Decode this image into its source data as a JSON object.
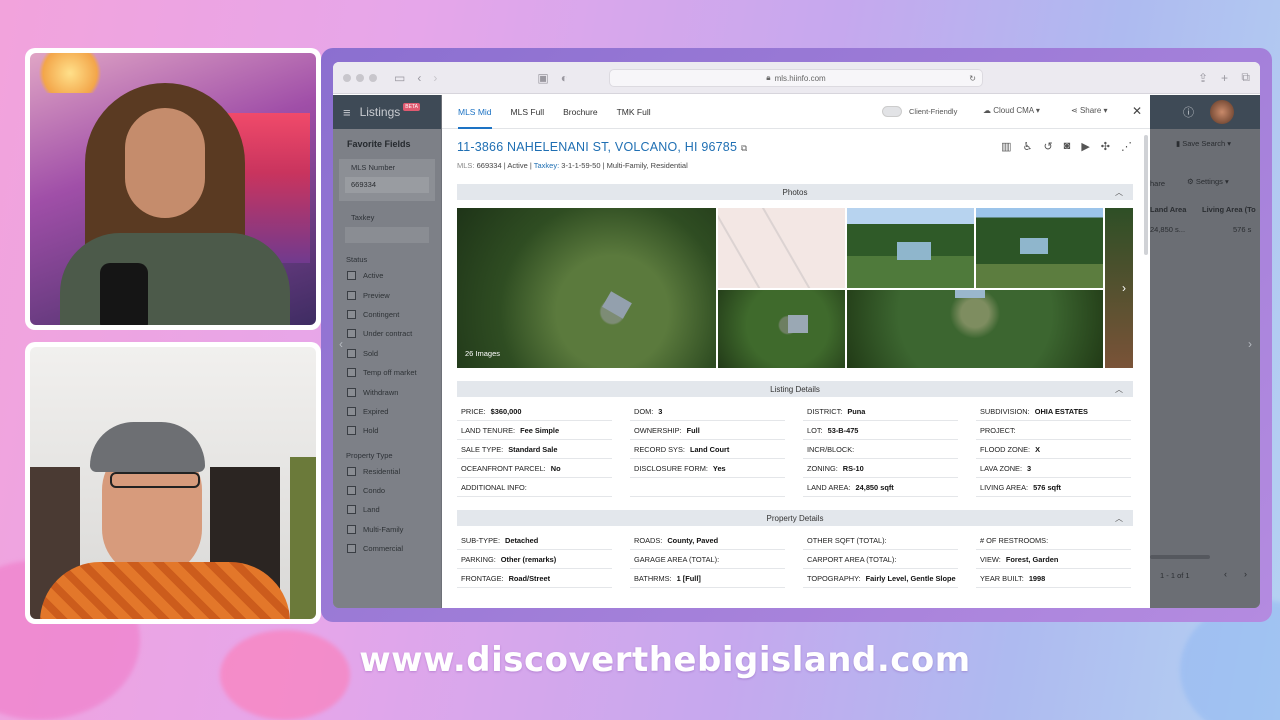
{
  "overlay": {
    "website": "www.discoverthebigisland.com"
  },
  "browser": {
    "url": "mls.hiinfo.com"
  },
  "app": {
    "brand": "Listings",
    "beta_badge": "BETA",
    "sidebar": {
      "section_title": "Favorite Fields",
      "mls_label": "MLS Number",
      "mls_value": "669334",
      "taxkey_label": "Taxkey",
      "status_label": "Status",
      "status_items": [
        "Active",
        "Preview",
        "Contingent",
        "Under contract",
        "Sold",
        "Temp off market",
        "Withdrawn",
        "Expired",
        "Hold"
      ],
      "ptype_label": "Property Type",
      "ptype_items": [
        "Residential",
        "Condo",
        "Land",
        "Multi-Family",
        "Commercial"
      ]
    },
    "right": {
      "save_search": "Save Search",
      "share": "hare",
      "settings": "Settings",
      "col1": "Land Area",
      "col2": "Living Area (To",
      "val1": "24,850 s...",
      "val2": "576 s",
      "pager": "1 - 1 of 1"
    }
  },
  "modal": {
    "tabs": [
      "MLS Mid",
      "MLS Full",
      "Brochure",
      "TMK Full"
    ],
    "client_friendly": "Client-Friendly",
    "cloud_cma": "Cloud CMA",
    "share": "Share",
    "address": "11-3866 NAHELENANI ST, VOLCANO, HI 96785",
    "mls_line": {
      "mls_label": "MLS:",
      "mls": "669334",
      "status": "Active",
      "taxkey_label": "Taxkey:",
      "taxkey": "3-1-1-59-50",
      "type": "Multi-Family, Residential"
    },
    "photos_title": "Photos",
    "images_count": "26 Images",
    "listing_title": "Listing Details",
    "listing": [
      {
        "label": "PRICE:",
        "value": "$360,000"
      },
      {
        "label": "DOM:",
        "value": "3"
      },
      {
        "label": "DISTRICT:",
        "value": "Puna"
      },
      {
        "label": "SUBDIVISION:",
        "value": "OHIA ESTATES"
      },
      {
        "label": "LAND TENURE:",
        "value": "Fee Simple"
      },
      {
        "label": "OWNERSHIP:",
        "value": "Full"
      },
      {
        "label": "LOT:",
        "value": "53-B-475"
      },
      {
        "label": "PROJECT:",
        "value": ""
      },
      {
        "label": "SALE TYPE:",
        "value": "Standard Sale"
      },
      {
        "label": "RECORD SYS:",
        "value": "Land Court"
      },
      {
        "label": "INCR/BLOCK:",
        "value": ""
      },
      {
        "label": "FLOOD ZONE:",
        "value": "X"
      },
      {
        "label": "OCEANFRONT PARCEL:",
        "value": "No"
      },
      {
        "label": "DISCLOSURE FORM:",
        "value": "Yes"
      },
      {
        "label": "ZONING:",
        "value": "RS-10"
      },
      {
        "label": "LAVA ZONE:",
        "value": "3"
      },
      {
        "label": "ADDITIONAL INFO:",
        "value": ""
      },
      {
        "label": "",
        "value": ""
      },
      {
        "label": "LAND AREA:",
        "value": "24,850 sqft"
      },
      {
        "label": "LIVING AREA:",
        "value": "576 sqft"
      }
    ],
    "property_title": "Property Details",
    "property": [
      {
        "label": "SUB-TYPE:",
        "value": "Detached"
      },
      {
        "label": "ROADS:",
        "value": "County, Paved"
      },
      {
        "label": "OTHER SQFT (TOTAL):",
        "value": ""
      },
      {
        "label": "# OF RESTROOMS:",
        "value": ""
      },
      {
        "label": "PARKING:",
        "value": "Other (remarks)"
      },
      {
        "label": "GARAGE AREA (TOTAL):",
        "value": ""
      },
      {
        "label": "CARPORT AREA (TOTAL):",
        "value": ""
      },
      {
        "label": "VIEW:",
        "value": "Forest, Garden"
      },
      {
        "label": "FRONTAGE:",
        "value": "Road/Street"
      },
      {
        "label": "BATHRMS:",
        "value": "1 [Full]"
      },
      {
        "label": "TOPOGRAPHY:",
        "value": "Fairly Level, Gentle Slope"
      },
      {
        "label": "YEAR BUILT:",
        "value": "1998"
      }
    ]
  },
  "colors": {
    "link": "#1d73c4",
    "header_dark": "#3e4a56",
    "section_bg": "#e3e7ec"
  },
  "icons": [
    "map-icon",
    "accessibility-icon",
    "history-icon",
    "camera-icon",
    "video-icon",
    "drone-icon",
    "chart-icon"
  ]
}
